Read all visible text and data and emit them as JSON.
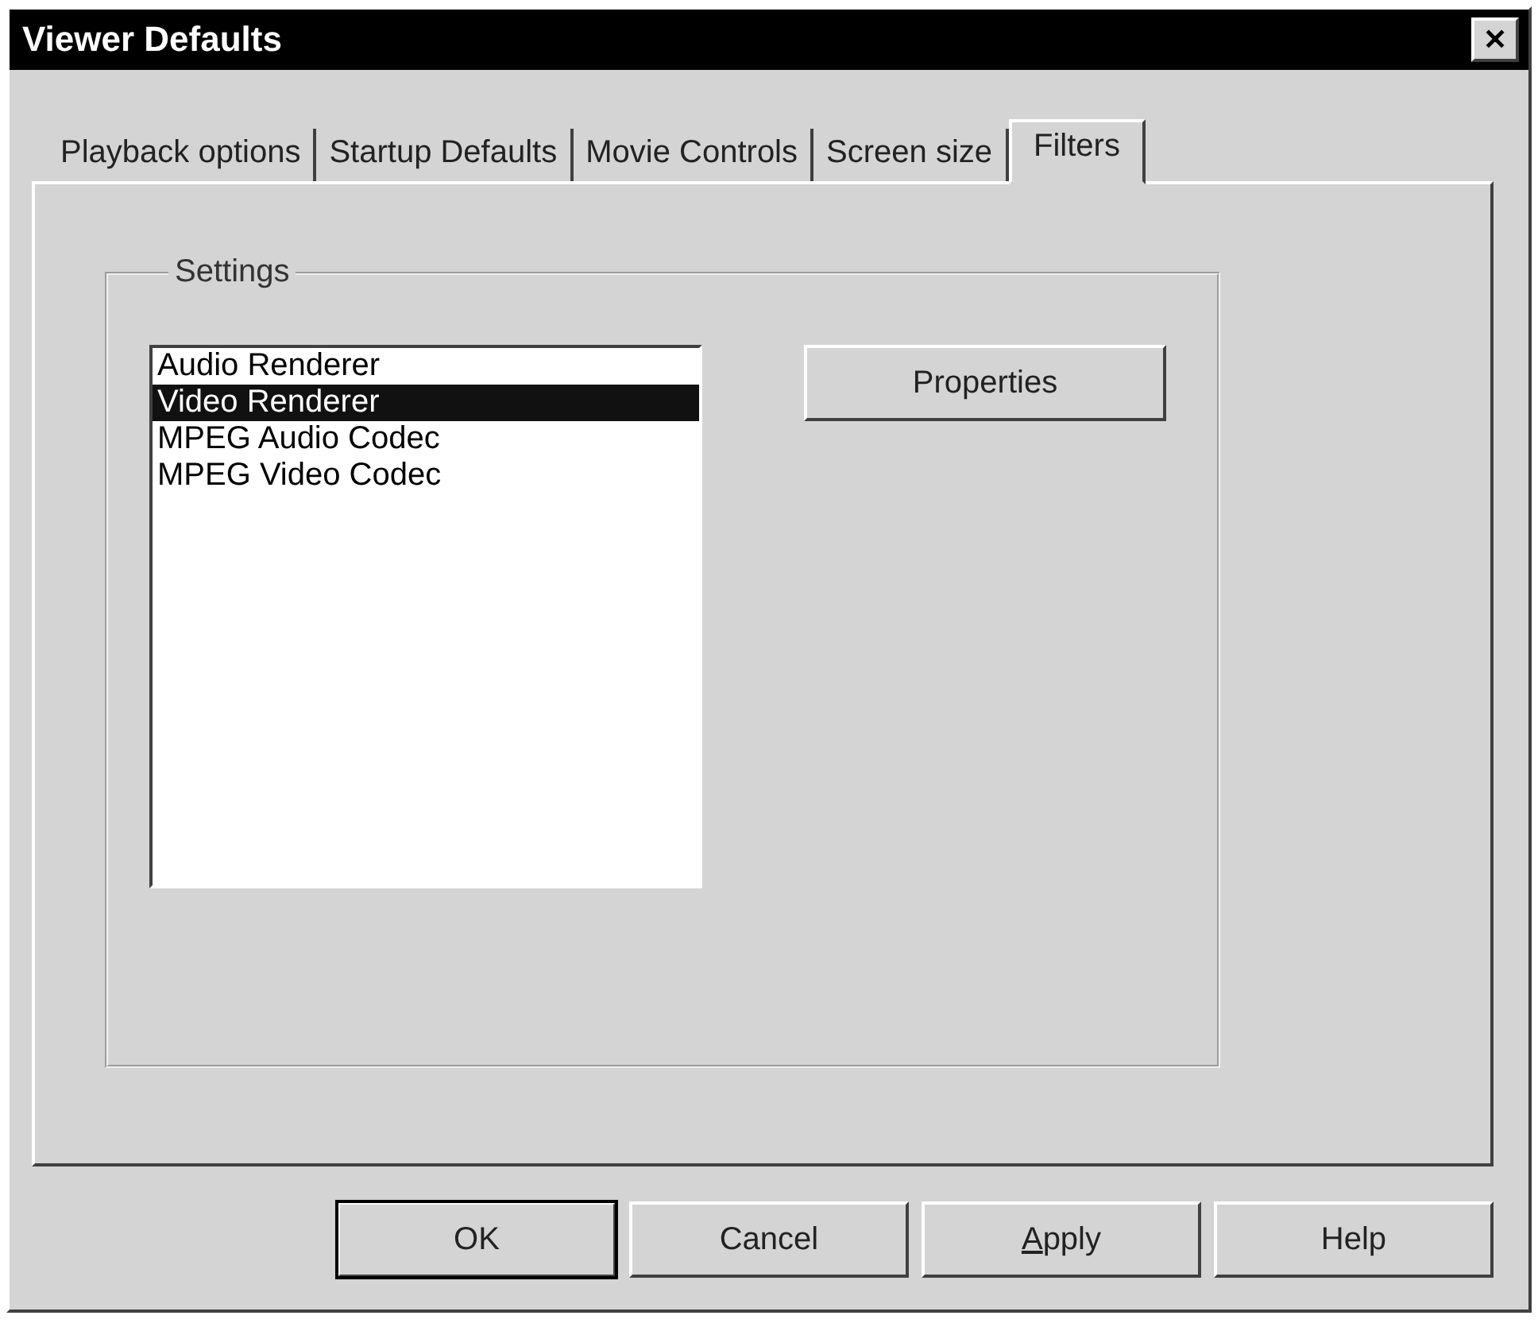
{
  "window": {
    "title": "Viewer Defaults",
    "close_label": "✕"
  },
  "tabs": [
    {
      "label": "Playback options",
      "selected": false
    },
    {
      "label": "Startup Defaults",
      "selected": false
    },
    {
      "label": "Movie Controls",
      "selected": false
    },
    {
      "label": "Screen size",
      "selected": false
    },
    {
      "label": "Filters",
      "selected": true
    }
  ],
  "group": {
    "title": "Settings"
  },
  "filters": [
    {
      "label": "Audio Renderer",
      "selected": false
    },
    {
      "label": "Video Renderer",
      "selected": true
    },
    {
      "label": "MPEG Audio Codec",
      "selected": false
    },
    {
      "label": "MPEG Video Codec",
      "selected": false
    }
  ],
  "properties_button": "Properties",
  "buttons": [
    {
      "label": "OK",
      "default": true,
      "underline_first": false
    },
    {
      "label": "Cancel",
      "default": false,
      "underline_first": false
    },
    {
      "label": "Apply",
      "default": false,
      "underline_first": true
    },
    {
      "label": "Help",
      "default": false,
      "underline_first": false
    }
  ]
}
